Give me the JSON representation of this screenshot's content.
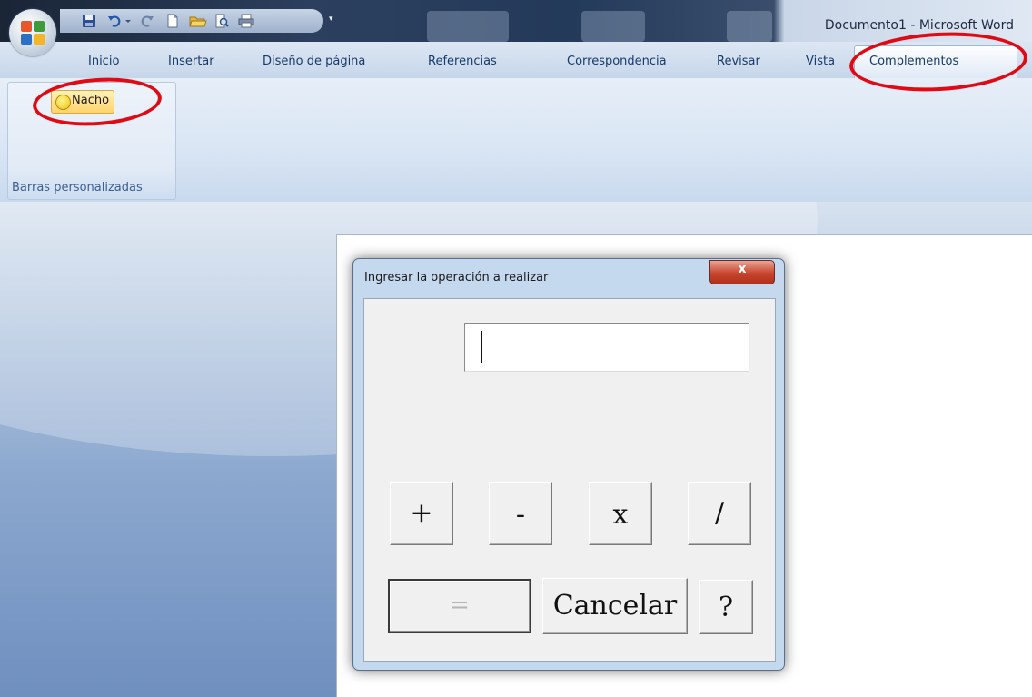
{
  "window": {
    "title": "Documento1 - Microsoft Word"
  },
  "office_button": {
    "icon": "office-logo-icon"
  },
  "quick_access_toolbar": {
    "buttons": [
      "save-icon",
      "undo-icon",
      "redo-icon",
      "new-document-icon",
      "open-folder-icon",
      "print-preview-icon",
      "quick-print-icon"
    ],
    "customize": "customize-toolbar-icon"
  },
  "ribbon": {
    "tabs": [
      {
        "label": "Inicio"
      },
      {
        "label": "Insertar"
      },
      {
        "label": "Diseño de página"
      },
      {
        "label": "Referencias"
      },
      {
        "label": "Correspondencia"
      },
      {
        "label": "Revisar"
      },
      {
        "label": "Vista"
      },
      {
        "label": "Complementos",
        "active": true
      }
    ],
    "group": {
      "label": "Barras personalizadas",
      "button": {
        "label": "Nacho",
        "icon": "smiley-icon"
      }
    }
  },
  "dialog": {
    "title": "Ingresar la operación a realizar",
    "close_label": "x",
    "input_value": "",
    "buttons": {
      "add": "+",
      "subtract": "-",
      "multiply": "x",
      "divide": "/",
      "equals": "=",
      "cancel": "Cancelar",
      "help": "?"
    }
  },
  "colors": {
    "annotation": "#e00a14",
    "tab_text": "#173a6a",
    "group_label": "#3b5f95"
  }
}
